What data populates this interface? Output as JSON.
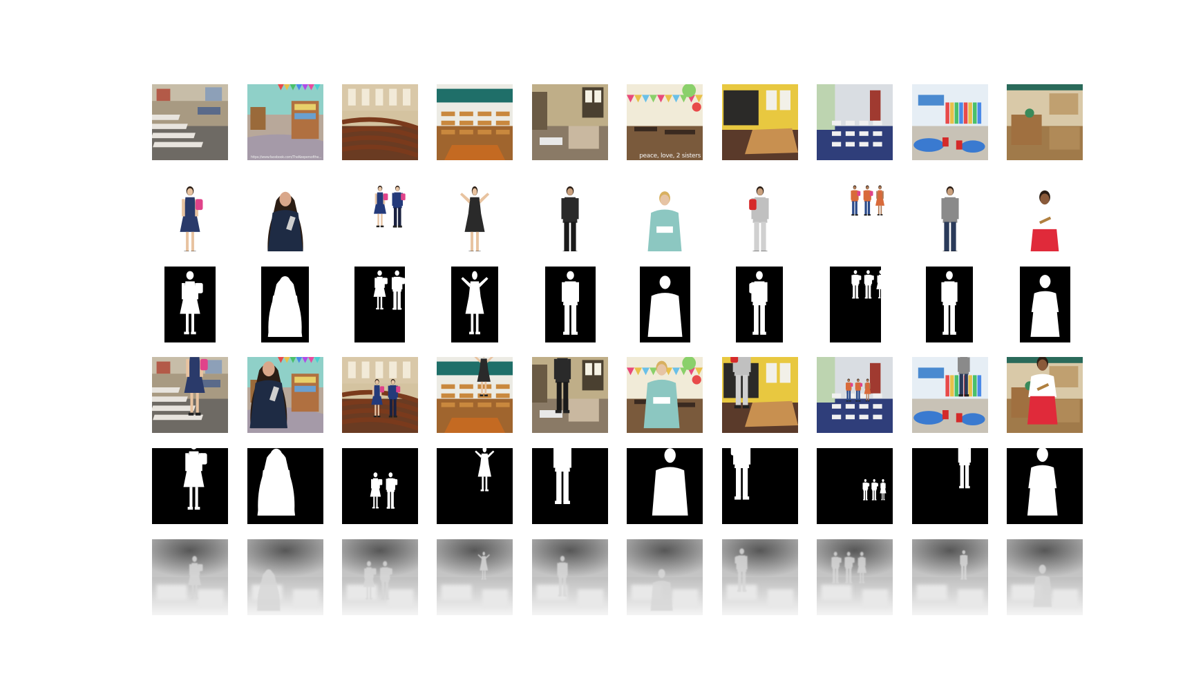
{
  "figure": {
    "rows": [
      {
        "key": "background",
        "kind": "scene"
      },
      {
        "key": "person",
        "kind": "person"
      },
      {
        "key": "person-mask",
        "kind": "mask-crop"
      },
      {
        "key": "composite",
        "kind": "composite"
      },
      {
        "key": "composite-mask",
        "kind": "mask-full"
      },
      {
        "key": "depth-map",
        "kind": "depth"
      }
    ],
    "columns": [
      {
        "scene": "classroom-rows",
        "figures": [
          "girl-backpack"
        ],
        "skin": "#e8c3a0",
        "top": "#5a2a6a",
        "bottom": "#2a3a6a",
        "bag": "#e0438a",
        "wall": "#a89a82",
        "floor": "#6e6a64",
        "accent": "#d8d8d8",
        "watermark": ""
      },
      {
        "scene": "nursery-shelves",
        "figures": [
          "woman-book"
        ],
        "skin": "#d9a78a",
        "top": "#1e2b44",
        "bottom": "#1e2b44",
        "bag": "#cfcfcf",
        "wall": "#8fd0c8",
        "floor": "#b59a88",
        "accent": "#e84a8a",
        "watermark": "https://www.facebook.com/TheKeepersofthe..."
      },
      {
        "scene": "lecture-hall",
        "figures": [
          "schoolgirl",
          "schoolboy"
        ],
        "skin": "#e6c4a5",
        "top": "#243a7a",
        "bottom": "#1a2140",
        "bag": "#e0438a",
        "wall": "#d4c3a0",
        "floor": "#6a3b22",
        "accent": "#8a5030",
        "watermark": ""
      },
      {
        "scene": "chalkboard-desks",
        "figures": [
          "girl-dress"
        ],
        "skin": "#e8c3a0",
        "top": "#2a2a2a",
        "bottom": "#2a2a2a",
        "bag": "#2a2a2a",
        "wall": "#ecebe4",
        "floor": "#a0652e",
        "accent": "#1f7a74",
        "watermark": ""
      },
      {
        "scene": "bright-window-room",
        "figures": [
          "man-suit"
        ],
        "skin": "#c9a07d",
        "top": "#2a2a2a",
        "bottom": "#1a1a1a",
        "bag": "#2a2a2a",
        "wall": "#bfae88",
        "floor": "#8a7a66",
        "accent": "#d8d0c0",
        "watermark": ""
      },
      {
        "scene": "party-decor",
        "figures": [
          "woman-apron"
        ],
        "skin": "#e6c4a5",
        "top": "#8cc7c1",
        "bottom": "#8cc7c1",
        "bag": "#ffffff",
        "wall": "#f1ebd8",
        "floor": "#7a5a3c",
        "accent": "#e84a7a",
        "watermark": "peace, love, 2 sisters"
      },
      {
        "scene": "dark-chalkboard",
        "figures": [
          "boy-red-backpack"
        ],
        "skin": "#c9a07d",
        "top": "#c0c0c0",
        "bottom": "#d0d0d0",
        "bag": "#d62a2a",
        "wall": "#2b2a28",
        "floor": "#5a3a2a",
        "accent": "#e3c23a",
        "watermark": ""
      },
      {
        "scene": "white-classroom",
        "figures": [
          "kid-a",
          "kid-b",
          "kid-c"
        ],
        "skin": "#b07a55",
        "top": "#d86a3a",
        "bottom": "#2a4a8a",
        "bag": "#e0438a",
        "wall": "#d9dde2",
        "floor": "#2f3e7a",
        "accent": "#ffffff",
        "watermark": ""
      },
      {
        "scene": "colorful-tables",
        "figures": [
          "man-casual"
        ],
        "skin": "#c9a07d",
        "top": "#8a8a8a",
        "bottom": "#2a3a5a",
        "bag": "#2a2a2a",
        "wall": "#e6eef5",
        "floor": "#c8c2b6",
        "accent": "#d42a2a",
        "watermark": ""
      },
      {
        "scene": "montessori-room",
        "figures": [
          "woman-red-skirt"
        ],
        "skin": "#8a5a3a",
        "top": "#ffffff",
        "bottom": "#e02a3a",
        "bag": "#e02a3a",
        "wall": "#d9c9a8",
        "floor": "#a07a4a",
        "accent": "#3a8a5a",
        "watermark": ""
      }
    ]
  }
}
